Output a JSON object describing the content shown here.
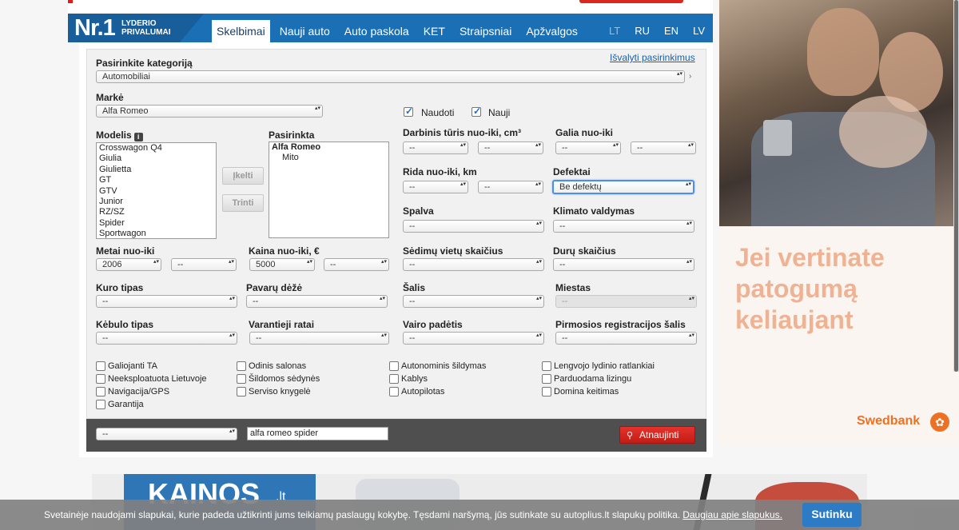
{
  "header": {
    "logo_nr": "Nr.1",
    "logo_sub1": "LYDERIO",
    "logo_sub2": "PRIVALUMAI",
    "tabs": [
      "Skelbimai",
      "Nauji auto",
      "Auto paskola",
      "KET",
      "Straipsniai",
      "Apžvalgos"
    ],
    "langs": [
      "LT",
      "RU",
      "EN",
      "LV"
    ]
  },
  "form": {
    "category_label": "Pasirinkite kategoriją",
    "clear_link": "Išvalyti pasirinkimus",
    "category_value": "Automobiliai",
    "make_label": "Markė",
    "make_value": "Alfa Romeo",
    "used_label": "Naudoti",
    "new_label": "Nauji",
    "models_label": "Modelis",
    "info_icon_text": "i",
    "models": [
      "Crosswagon Q4",
      "Giulia",
      "Giulietta",
      "GT",
      "GTV",
      "Junior",
      "RZ/SZ",
      "Spider",
      "Sportwagon"
    ],
    "selected_label": "Pasirinkta",
    "selected_make": "Alfa Romeo",
    "selected_model": "Mito",
    "add_button": "Įkelti",
    "remove_button": "Trinti",
    "engine_label": "Darbinis tūris nuo-iki, cm³",
    "power_label": "Galia nuo-iki",
    "mileage_label": "Rida nuo-iki, km",
    "defects_label": "Defektai",
    "defects_value": "Be defektų",
    "color_label": "Spalva",
    "climate_label": "Klimato valdymas",
    "year_label": "Metai nuo-iki",
    "year_from": "2006",
    "price_label": "Kaina nuo-iki, €",
    "price_from": "5000",
    "seats_label": "Sėdimų vietų skaičius",
    "doors_label": "Durų skaičius",
    "fuel_label": "Kuro tipas",
    "gearbox_label": "Pavarų dėžė",
    "country_label": "Šalis",
    "city_label": "Miestas",
    "body_label": "Kėbulo tipas",
    "drive_label": "Varantieji ratai",
    "steering_label": "Vairo padėtis",
    "reg_country_label": "Pirmosios registracijos šalis",
    "empty": "--",
    "features": [
      "Galiojanti TA",
      "Neeksploatuota Lietuvoje",
      "Navigacija/GPS",
      "Garantija",
      "Odinis salonas",
      "Šildomos sėdynės",
      "Serviso knygelė",
      "Autonominis šildymas",
      "Kablys",
      "Autopilotas",
      "Lengvojo lydinio ratlankiai",
      "Parduodama lizingu",
      "Domina keitimas"
    ],
    "search_text": "alfa romeo spider",
    "refresh_button": "Atnaujinti"
  },
  "ad": {
    "line1": "Jei vertinate",
    "line2": "patogumą",
    "line3": "keliaujant",
    "brand": "Swedbank"
  },
  "banner": {
    "title": "KAINOS",
    "suffix": ".lt"
  },
  "cookie": {
    "text": "Svetainėje naudojami slapukai, kurie padeda užtikrinti jums teikiamų paslaugų kokybę. Tęsdami naršymą, jūs sutinkate su autoplius.lt slapukų politika.",
    "link": "Daugiau apie slapukus.",
    "button": "Sutinku"
  },
  "colors": {
    "nav_blue": "#1a6fb5",
    "accent_red": "#d9281f",
    "ad_text": "#efb293",
    "swedbank_orange": "#ee7023"
  }
}
